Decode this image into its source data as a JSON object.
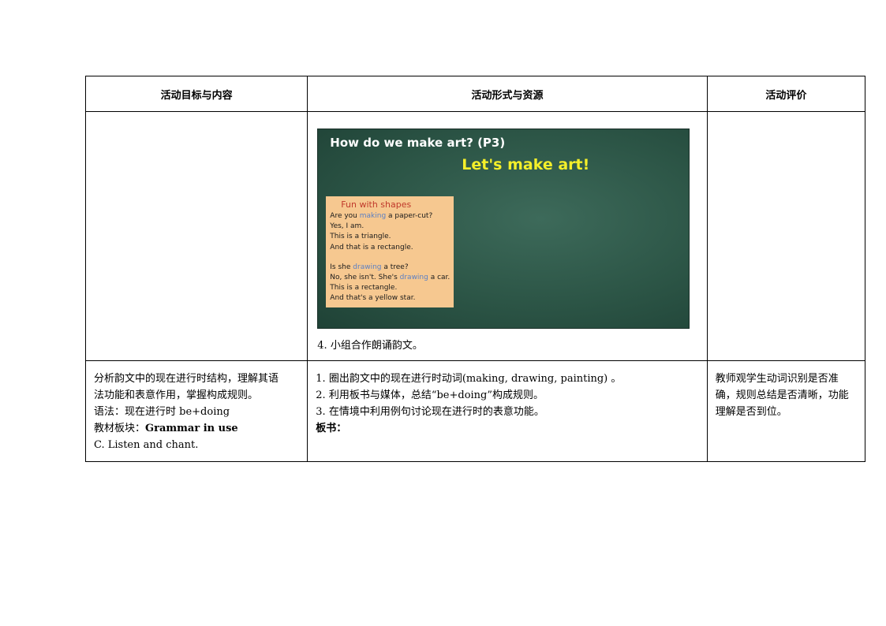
{
  "table": {
    "headers": [
      "活动目标与内容",
      "活动形式与资源",
      "活动评价"
    ],
    "slide": {
      "question": "How do we make art?   (P3)",
      "title": "Let's make art!",
      "card_title": "Fun with shapes",
      "card_lines_1": [
        [
          "Are you ",
          "making",
          " a paper-cut?"
        ],
        [
          "Yes, I am."
        ],
        [
          "This is a triangle."
        ],
        [
          "And that is a rectangle."
        ]
      ],
      "card_lines_2": [
        [
          "Is she ",
          "drawing",
          " a tree?"
        ],
        [
          "No, she isn't. She's ",
          "drawing",
          " a car."
        ],
        [
          "This is a rectangle."
        ],
        [
          "And that's a yellow star."
        ]
      ]
    },
    "row1_caption": "4.  小组合作朗诵韵文。",
    "row2": {
      "goals": [
        "分析韵文中的现在进行时结构，理解其语",
        "法功能和表意作用，掌握构成规则。",
        "语法：现在进行时 be+doing"
      ],
      "module_label": "教材板块：",
      "module_value": "Grammar in use",
      "sub": "C. Listen and chant.",
      "activities": [
        "1.  圈出韵文中的现在进行时动词(making, drawing, painting) 。",
        "2.  利用板书与媒体，总结“be+doing”构成规则。",
        "3.  在情境中利用例句讨论现在进行时的表意功能。"
      ],
      "board": "板书：",
      "evaluation": [
        "教师观学生动词识别是否准",
        "确，规则总结是否清晰，功能",
        "理解是否到位。"
      ]
    }
  }
}
